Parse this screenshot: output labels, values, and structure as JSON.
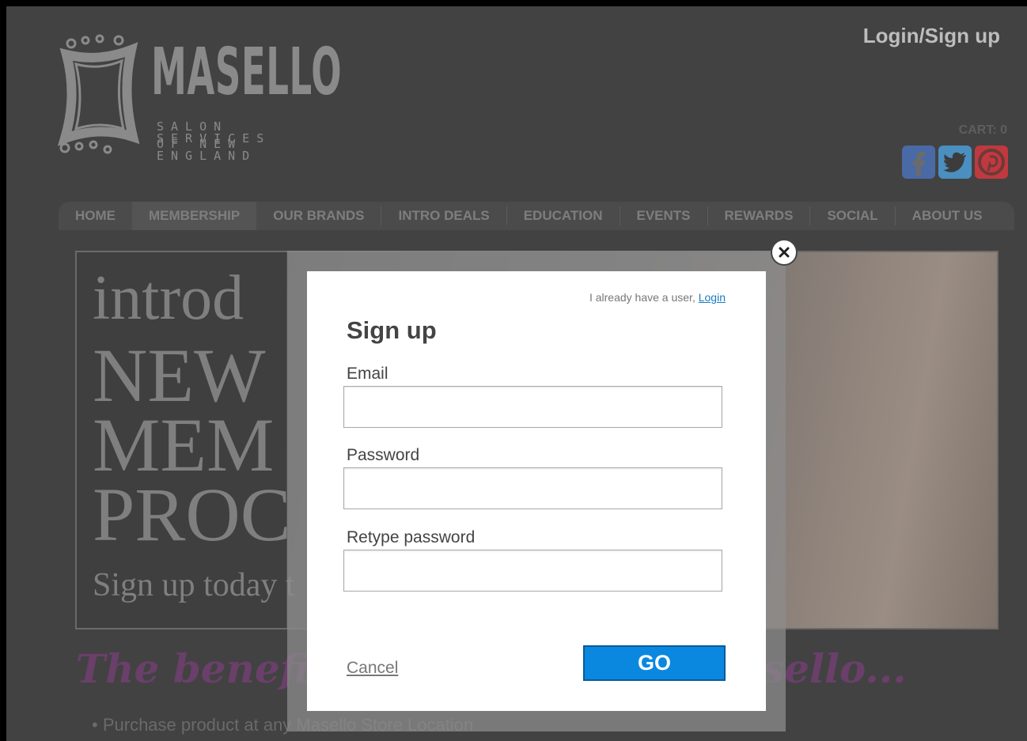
{
  "header": {
    "logo": {
      "name": "MASELLO",
      "line1": "SALON SERVICES",
      "line2": "OF NEW ENGLAND"
    },
    "login_label": "Login/Sign up",
    "cart_label": "CART: 0",
    "social": [
      "facebook-icon",
      "twitter-icon",
      "pinterest-icon"
    ]
  },
  "nav": {
    "items": [
      {
        "label": "HOME",
        "active": false
      },
      {
        "label": "MEMBERSHIP",
        "active": true
      },
      {
        "label": "OUR BRANDS",
        "active": false
      },
      {
        "label": "INTRO DEALS",
        "active": false
      },
      {
        "label": "EDUCATION",
        "active": false
      },
      {
        "label": "EVENTS",
        "active": false
      },
      {
        "label": "REWARDS",
        "active": false
      },
      {
        "label": "SOCIAL",
        "active": false
      },
      {
        "label": "ABOUT US",
        "active": false
      }
    ]
  },
  "banner": {
    "line1": "introd",
    "line2": "NEW",
    "line3": "MEM",
    "line4": "PROC",
    "line5": "Sign up today t"
  },
  "main": {
    "benefits_heading": "The benefits o",
    "benefits_heading_tail": "sello...",
    "bullet_text": "Purchase product at any Masello Store Location"
  },
  "dialog": {
    "already_text": "I already have a user,",
    "login_link": "Login",
    "title": "Sign up",
    "email_label": "Email",
    "email_value": "",
    "password_label": "Password",
    "password_value": "",
    "retype_label": "Retype password",
    "retype_value": "",
    "cancel_label": "Cancel",
    "go_label": "GO"
  },
  "colors": {
    "page_bg": "#424242",
    "go_button": "#0a88e0",
    "link": "#1a7bbf",
    "facebook": "#4a6aa5",
    "twitter": "#4a8fc0",
    "pinterest": "#c0393e"
  }
}
